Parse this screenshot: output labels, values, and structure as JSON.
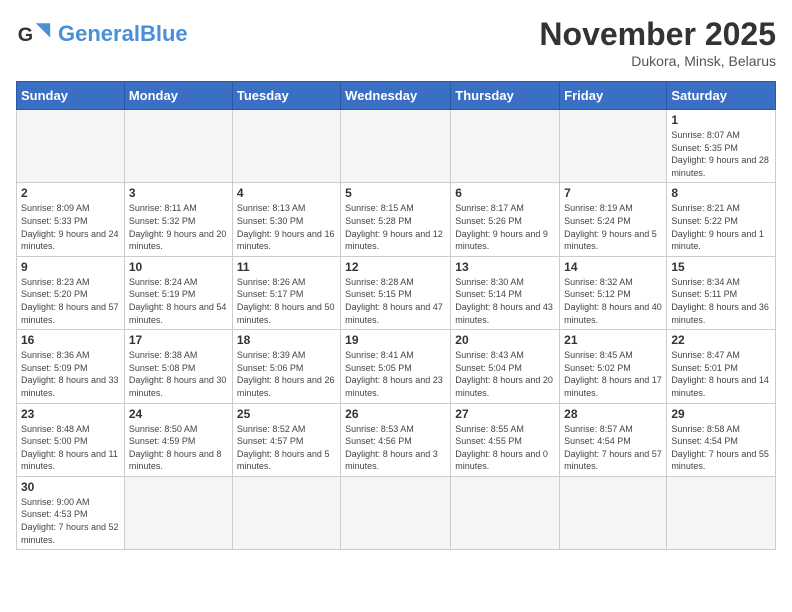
{
  "header": {
    "logo_general": "General",
    "logo_blue": "Blue",
    "title": "November 2025",
    "subtitle": "Dukora, Minsk, Belarus"
  },
  "weekdays": [
    "Sunday",
    "Monday",
    "Tuesday",
    "Wednesday",
    "Thursday",
    "Friday",
    "Saturday"
  ],
  "weeks": [
    [
      {
        "day": "",
        "info": ""
      },
      {
        "day": "",
        "info": ""
      },
      {
        "day": "",
        "info": ""
      },
      {
        "day": "",
        "info": ""
      },
      {
        "day": "",
        "info": ""
      },
      {
        "day": "",
        "info": ""
      },
      {
        "day": "1",
        "info": "Sunrise: 8:07 AM\nSunset: 5:35 PM\nDaylight: 9 hours\nand 28 minutes."
      }
    ],
    [
      {
        "day": "2",
        "info": "Sunrise: 8:09 AM\nSunset: 5:33 PM\nDaylight: 9 hours\nand 24 minutes."
      },
      {
        "day": "3",
        "info": "Sunrise: 8:11 AM\nSunset: 5:32 PM\nDaylight: 9 hours\nand 20 minutes."
      },
      {
        "day": "4",
        "info": "Sunrise: 8:13 AM\nSunset: 5:30 PM\nDaylight: 9 hours\nand 16 minutes."
      },
      {
        "day": "5",
        "info": "Sunrise: 8:15 AM\nSunset: 5:28 PM\nDaylight: 9 hours\nand 12 minutes."
      },
      {
        "day": "6",
        "info": "Sunrise: 8:17 AM\nSunset: 5:26 PM\nDaylight: 9 hours\nand 9 minutes."
      },
      {
        "day": "7",
        "info": "Sunrise: 8:19 AM\nSunset: 5:24 PM\nDaylight: 9 hours\nand 5 minutes."
      },
      {
        "day": "8",
        "info": "Sunrise: 8:21 AM\nSunset: 5:22 PM\nDaylight: 9 hours\nand 1 minute."
      }
    ],
    [
      {
        "day": "9",
        "info": "Sunrise: 8:23 AM\nSunset: 5:20 PM\nDaylight: 8 hours\nand 57 minutes."
      },
      {
        "day": "10",
        "info": "Sunrise: 8:24 AM\nSunset: 5:19 PM\nDaylight: 8 hours\nand 54 minutes."
      },
      {
        "day": "11",
        "info": "Sunrise: 8:26 AM\nSunset: 5:17 PM\nDaylight: 8 hours\nand 50 minutes."
      },
      {
        "day": "12",
        "info": "Sunrise: 8:28 AM\nSunset: 5:15 PM\nDaylight: 8 hours\nand 47 minutes."
      },
      {
        "day": "13",
        "info": "Sunrise: 8:30 AM\nSunset: 5:14 PM\nDaylight: 8 hours\nand 43 minutes."
      },
      {
        "day": "14",
        "info": "Sunrise: 8:32 AM\nSunset: 5:12 PM\nDaylight: 8 hours\nand 40 minutes."
      },
      {
        "day": "15",
        "info": "Sunrise: 8:34 AM\nSunset: 5:11 PM\nDaylight: 8 hours\nand 36 minutes."
      }
    ],
    [
      {
        "day": "16",
        "info": "Sunrise: 8:36 AM\nSunset: 5:09 PM\nDaylight: 8 hours\nand 33 minutes."
      },
      {
        "day": "17",
        "info": "Sunrise: 8:38 AM\nSunset: 5:08 PM\nDaylight: 8 hours\nand 30 minutes."
      },
      {
        "day": "18",
        "info": "Sunrise: 8:39 AM\nSunset: 5:06 PM\nDaylight: 8 hours\nand 26 minutes."
      },
      {
        "day": "19",
        "info": "Sunrise: 8:41 AM\nSunset: 5:05 PM\nDaylight: 8 hours\nand 23 minutes."
      },
      {
        "day": "20",
        "info": "Sunrise: 8:43 AM\nSunset: 5:04 PM\nDaylight: 8 hours\nand 20 minutes."
      },
      {
        "day": "21",
        "info": "Sunrise: 8:45 AM\nSunset: 5:02 PM\nDaylight: 8 hours\nand 17 minutes."
      },
      {
        "day": "22",
        "info": "Sunrise: 8:47 AM\nSunset: 5:01 PM\nDaylight: 8 hours\nand 14 minutes."
      }
    ],
    [
      {
        "day": "23",
        "info": "Sunrise: 8:48 AM\nSunset: 5:00 PM\nDaylight: 8 hours\nand 11 minutes."
      },
      {
        "day": "24",
        "info": "Sunrise: 8:50 AM\nSunset: 4:59 PM\nDaylight: 8 hours\nand 8 minutes."
      },
      {
        "day": "25",
        "info": "Sunrise: 8:52 AM\nSunset: 4:57 PM\nDaylight: 8 hours\nand 5 minutes."
      },
      {
        "day": "26",
        "info": "Sunrise: 8:53 AM\nSunset: 4:56 PM\nDaylight: 8 hours\nand 3 minutes."
      },
      {
        "day": "27",
        "info": "Sunrise: 8:55 AM\nSunset: 4:55 PM\nDaylight: 8 hours\nand 0 minutes."
      },
      {
        "day": "28",
        "info": "Sunrise: 8:57 AM\nSunset: 4:54 PM\nDaylight: 7 hours\nand 57 minutes."
      },
      {
        "day": "29",
        "info": "Sunrise: 8:58 AM\nSunset: 4:54 PM\nDaylight: 7 hours\nand 55 minutes."
      }
    ],
    [
      {
        "day": "30",
        "info": "Sunrise: 9:00 AM\nSunset: 4:53 PM\nDaylight: 7 hours\nand 52 minutes."
      },
      {
        "day": "",
        "info": ""
      },
      {
        "day": "",
        "info": ""
      },
      {
        "day": "",
        "info": ""
      },
      {
        "day": "",
        "info": ""
      },
      {
        "day": "",
        "info": ""
      },
      {
        "day": "",
        "info": ""
      }
    ]
  ]
}
